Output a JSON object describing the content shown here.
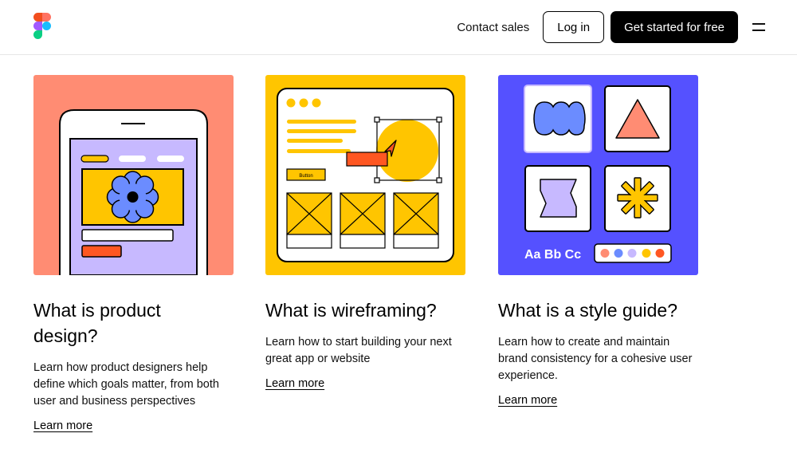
{
  "header": {
    "contact_label": "Contact sales",
    "login_label": "Log in",
    "start_label": "Get started for free"
  },
  "cards": [
    {
      "title_line1": "What is product",
      "title_line2": "design?",
      "description": "Learn how product designers help define which goals matter, from both user and business perspectives",
      "link": "Learn more"
    },
    {
      "title": "What is wireframing?",
      "description": "Learn how to start building your next great app or website",
      "link": "Learn more",
      "illustration_button_label": "Button"
    },
    {
      "title": "What is a style guide?",
      "description": "Learn how to create and maintain brand consistency for a cohesive user experience.",
      "link": "Learn more",
      "illustration_type_sample": "Aa Bb Cc"
    }
  ],
  "colors": {
    "salmon": "#ff8c73",
    "yellow": "#ffc500",
    "blue": "#5551ff",
    "lavender": "#c7b9ff",
    "orange_red": "#ff5722",
    "light_blue": "#6b8cff",
    "pink": "#ff8c73"
  },
  "icons": [
    "figma-logo-icon",
    "hamburger-menu-icon",
    "flower-icon",
    "cursor-arrow-icon",
    "blob-icon",
    "triangle-icon",
    "flag-icon",
    "asterisk-icon"
  ]
}
